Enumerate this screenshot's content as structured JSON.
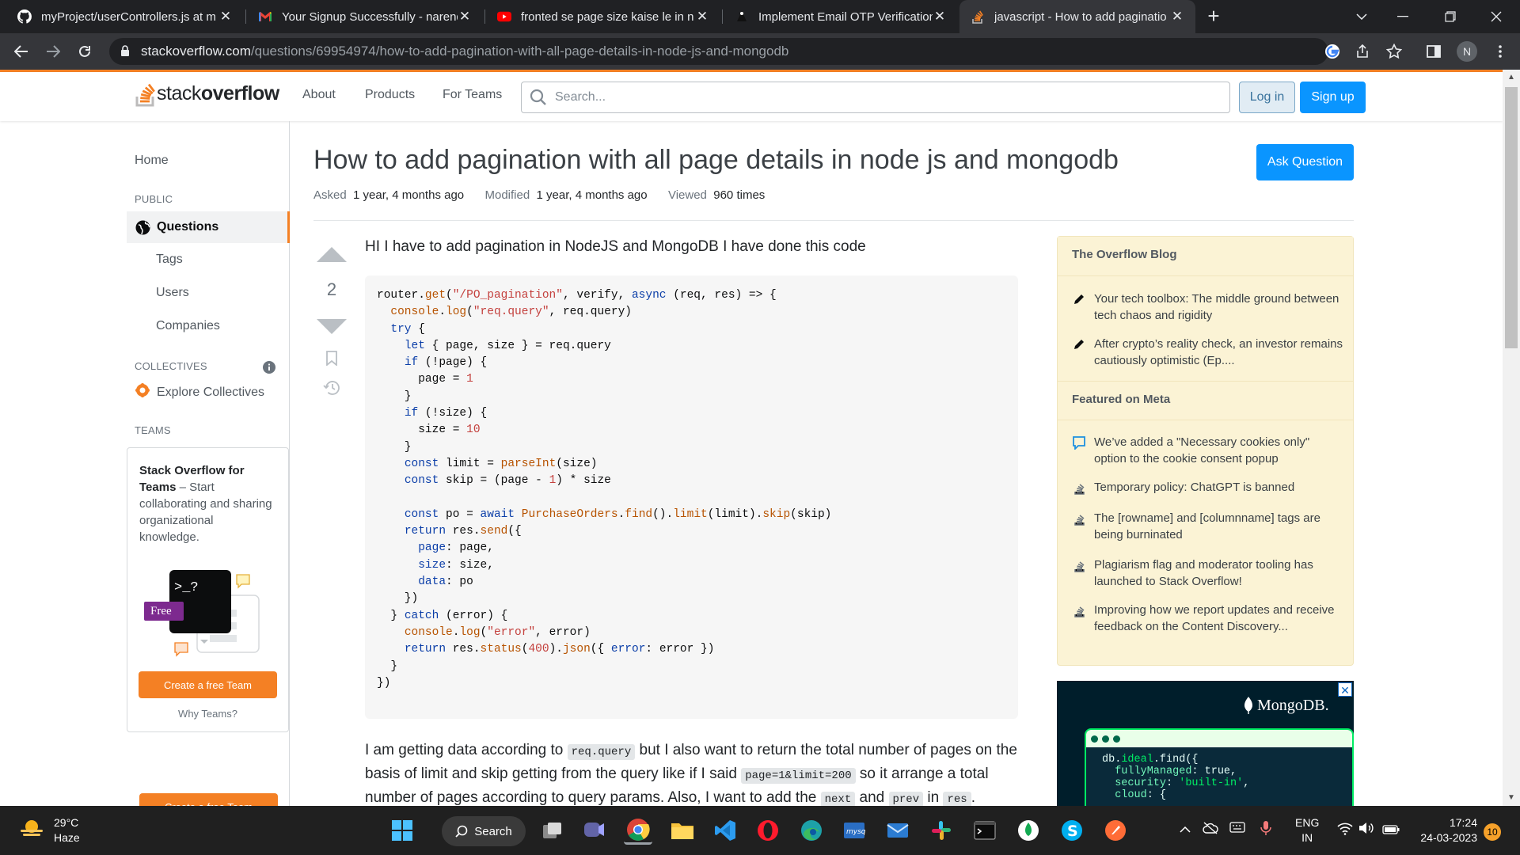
{
  "browser": {
    "tabs": [
      {
        "title": "myProject/userControllers.js at m",
        "icon": "github-icon"
      },
      {
        "title": "Your Signup Successfully - narend",
        "icon": "gmail-icon"
      },
      {
        "title": "fronted se page size kaise le in n",
        "icon": "youtube-icon"
      },
      {
        "title": "Implement Email OTP Verification",
        "icon": "medium-icon"
      },
      {
        "title": "javascript - How to add paginatio",
        "icon": "stackoverflow-icon",
        "active": true
      }
    ],
    "url_host": "stackoverflow.com",
    "url_path": "/questions/69954974/how-to-add-pagination-with-all-page-details-in-node-js-and-mongodb",
    "profile_initial": "N"
  },
  "header": {
    "logo_light": "stack",
    "logo_bold": "overflow",
    "nav": [
      "About",
      "Products",
      "For Teams"
    ],
    "search_placeholder": "Search...",
    "login": "Log in",
    "signup": "Sign up"
  },
  "sidebar": {
    "home": "Home",
    "public": "PUBLIC",
    "questions": "Questions",
    "tags": "Tags",
    "users": "Users",
    "companies": "Companies",
    "collectives": "COLLECTIVES",
    "explore": "Explore Collectives",
    "teams": "TEAMS",
    "teams_title": "Stack Overflow for Teams",
    "teams_desc": " – Start collaborating and sharing organizational knowledge.",
    "free": "Free",
    "create_team": "Create a free Team",
    "why_teams": "Why Teams?"
  },
  "question": {
    "title": "How to add pagination with all page details in node js and mongodb",
    "asked_label": "Asked",
    "asked": "1 year, 4 months ago",
    "modified_label": "Modified",
    "modified": "1 year, 4 months ago",
    "viewed_label": "Viewed",
    "viewed": "960 times",
    "ask_button": "Ask Question",
    "votes": "2",
    "intro": "HI I have to add pagination in NodeJS and MongoDB I have done this code",
    "p2_a": "I am getting data according to ",
    "code_a": "req.query",
    "p2_b": " but I also want to return the total number of pages on the basis of limit and skip getting from the query like if I said ",
    "code_b": "page=1&limit=200",
    "p2_c": " so it arrange a total number of pages according to query params. Also, I want to add the ",
    "code_c": "next",
    "p2_d": " and ",
    "code_d": "prev",
    "p2_e": " in ",
    "code_e": "res",
    "p2_f": "."
  },
  "blog": {
    "heading": "The Overflow Blog",
    "items": [
      "Your tech toolbox: The middle ground between tech chaos and rigidity",
      "After crypto’s reality check, an investor remains cautiously optimistic (Ep...."
    ],
    "meta_heading": "Featured on Meta",
    "meta_items": [
      "We’ve added a \"Necessary cookies only\" option to the cookie consent popup",
      "Temporary policy: ChatGPT is banned",
      "The [rowname] and [columnname] tags are being burninated",
      "Plagiarism flag and moderator tooling has launched to Stack Overflow!",
      "Improving how we report updates and receive feedback on the Content Discovery..."
    ]
  },
  "ad": {
    "brand": "MongoDB.",
    "close": "✕"
  },
  "taskbar": {
    "temp": "29°C",
    "weather": "Haze",
    "search": "Search",
    "lang1": "ENG",
    "lang2": "IN",
    "time": "17:24",
    "date": "24-03-2023",
    "notifications": "10"
  },
  "colors": {
    "accent": "#f48024",
    "primary": "#0a95ff",
    "blog_bg": "#fbf3d5"
  }
}
